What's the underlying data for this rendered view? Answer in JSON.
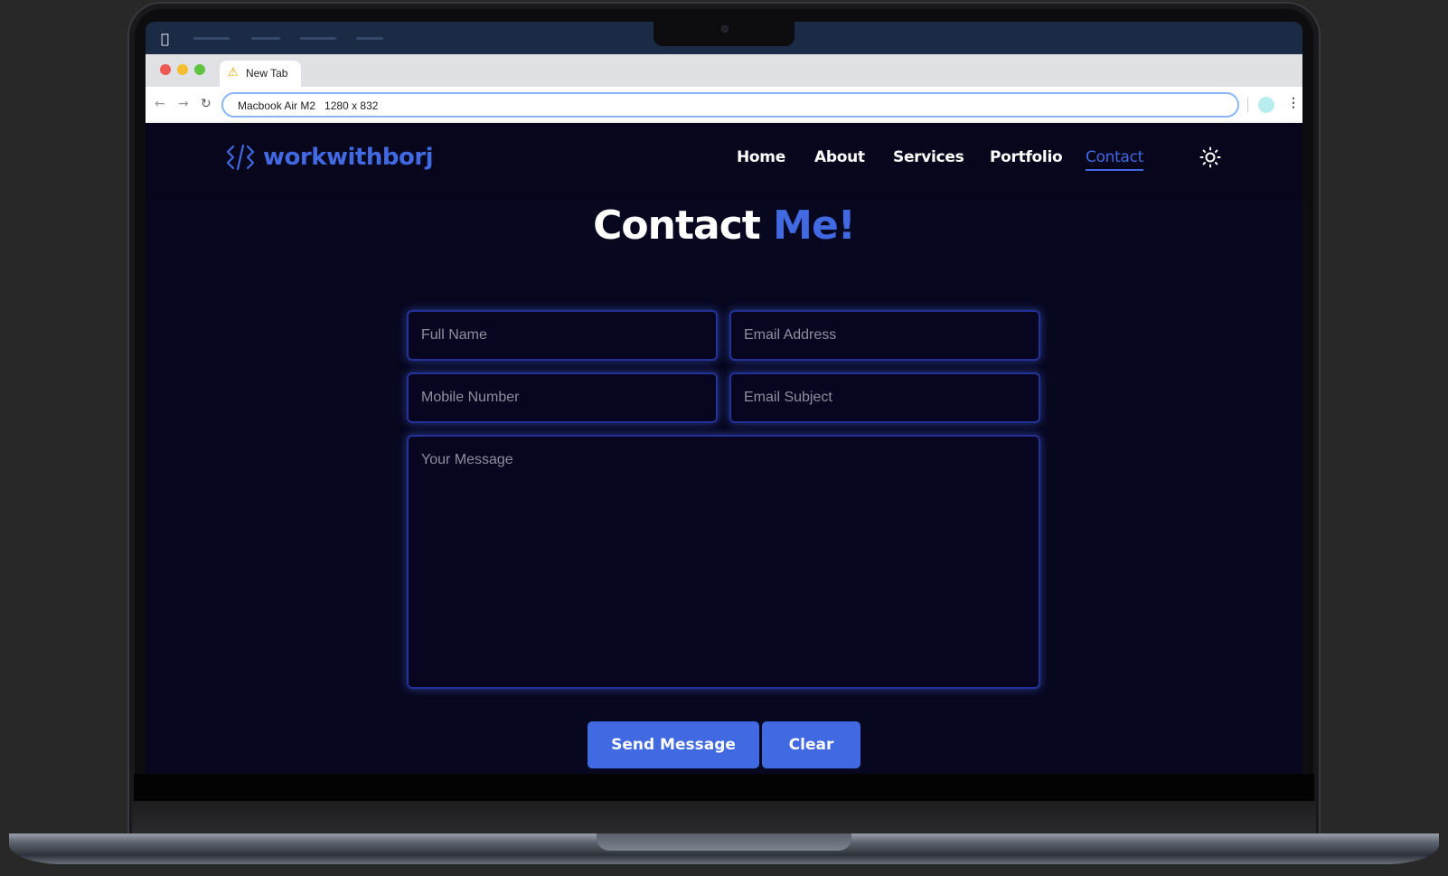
{
  "browser": {
    "tab_title": "New Tab",
    "address": "Macbook Air M2   1280 x 832"
  },
  "site": {
    "logo_text": "workwithborj",
    "nav": [
      {
        "label": "Home",
        "active": false
      },
      {
        "label": "About",
        "active": false
      },
      {
        "label": "Services",
        "active": false
      },
      {
        "label": "Portfolio",
        "active": false
      },
      {
        "label": "Contact",
        "active": true
      }
    ],
    "heading_main": "Contact",
    "heading_accent": "Me!",
    "form": {
      "full_name_placeholder": "Full Name",
      "email_placeholder": "Email Address",
      "mobile_placeholder": "Mobile Number",
      "subject_placeholder": "Email Subject",
      "message_placeholder": "Your Message"
    },
    "buttons": {
      "send": "Send Message",
      "clear": "Clear"
    },
    "colors": {
      "accent": "#4169e1",
      "background": "#080720"
    }
  }
}
